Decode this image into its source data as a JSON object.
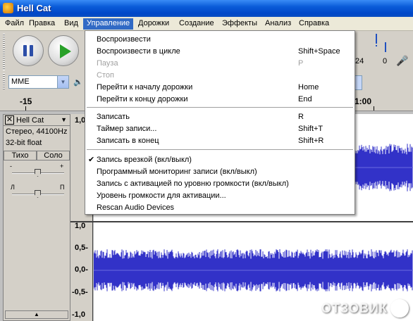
{
  "window": {
    "title": "Hell Cat"
  },
  "menubar": {
    "items": [
      {
        "label": "Файл",
        "active": false
      },
      {
        "label": "Правка",
        "active": false
      },
      {
        "label": "Вид",
        "active": false
      },
      {
        "label": "Управление",
        "active": true
      },
      {
        "label": "Дорожки",
        "active": false
      },
      {
        "label": "Создание",
        "active": false
      },
      {
        "label": "Эффекты",
        "active": false
      },
      {
        "label": "Анализ",
        "active": false
      },
      {
        "label": "Справка",
        "active": false
      }
    ]
  },
  "toolbar": {
    "device": "MME",
    "meter_numbers": [
      "24",
      "0"
    ]
  },
  "ruler": {
    "labels": [
      "-15",
      "1:00"
    ]
  },
  "track": {
    "name": "Hell Cat",
    "format": "Стерео, 44100Hz",
    "bit_depth": "32-bit float",
    "mute_label": "Тихо",
    "solo_label": "Соло",
    "gain_minus": "-",
    "gain_plus": "+",
    "pan_left": "Л",
    "pan_right": "П"
  },
  "scale_labels_top": [
    "1,0"
  ],
  "scale_labels_bottom": [
    "1,0",
    "0,5-",
    "0,0-",
    "-0,5-",
    "-1,0"
  ],
  "dropdown": {
    "items": [
      {
        "label": "Воспроизвести",
        "shortcut": "",
        "disabled": false,
        "checked": false
      },
      {
        "label": "Воспроизвести в цикле",
        "shortcut": "Shift+Space",
        "disabled": false,
        "checked": false
      },
      {
        "label": "Пауза",
        "shortcut": "P",
        "disabled": true,
        "checked": false
      },
      {
        "label": "Стоп",
        "shortcut": "",
        "disabled": true,
        "checked": false
      },
      {
        "label": "Перейти к началу дорожки",
        "shortcut": "Home",
        "disabled": false,
        "checked": false
      },
      {
        "label": "Перейти к концу дорожки",
        "shortcut": "End",
        "disabled": false,
        "checked": false
      },
      {
        "separator": true
      },
      {
        "label": "Записать",
        "shortcut": "R",
        "disabled": false,
        "checked": false
      },
      {
        "label": "Таймер записи...",
        "shortcut": "Shift+T",
        "disabled": false,
        "checked": false
      },
      {
        "label": "Записать в конец",
        "shortcut": "Shift+R",
        "disabled": false,
        "checked": false
      },
      {
        "separator": true
      },
      {
        "label": "Запись врезкой (вкл/выкл)",
        "shortcut": "",
        "disabled": false,
        "checked": true
      },
      {
        "label": "Программный мониторинг записи (вкл/выкл)",
        "shortcut": "",
        "disabled": false,
        "checked": false
      },
      {
        "label": "Запись с активацией по уровню громкости (вкл/выкл)",
        "shortcut": "",
        "disabled": false,
        "checked": false
      },
      {
        "label": "Уровень громкости для активации...",
        "shortcut": "",
        "disabled": false,
        "checked": false
      },
      {
        "label": "Rescan Audio Devices",
        "shortcut": "",
        "disabled": false,
        "checked": false
      }
    ]
  },
  "watermark": "ОТЗОВИК",
  "colors": {
    "waveform": "#3232c8",
    "menu_highlight": "#316ac5",
    "titlebar": "#0a5bd8"
  }
}
